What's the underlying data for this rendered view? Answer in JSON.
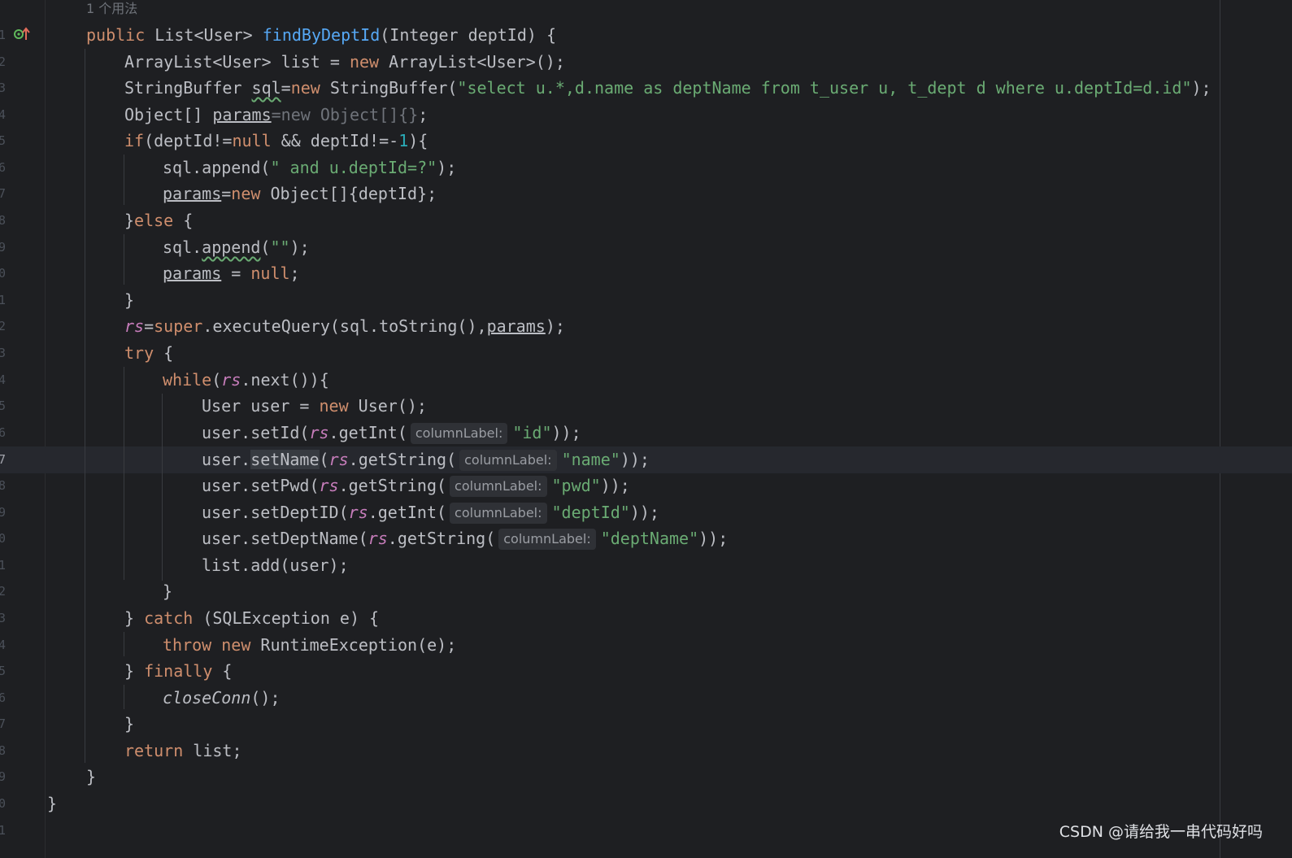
{
  "editor": {
    "usage_hint": "1 个用法",
    "watermark": "CSDN @请给我一串代码好吗"
  },
  "line_numbers": [
    "1",
    "2",
    "3",
    "4",
    "5",
    "6",
    "7",
    "8",
    "9",
    "0",
    "1",
    "2",
    "3",
    "4",
    "5",
    "6",
    "7",
    "8",
    "9",
    "0",
    "1",
    "2",
    "3",
    "4",
    "5",
    "6",
    "7",
    "8",
    "9",
    "0",
    "1"
  ],
  "code": {
    "l1": [
      "public",
      " List<User> ",
      "findByDeptId",
      "(Integer deptId) {"
    ],
    "l2": [
      "ArrayList<User> list = ",
      "new",
      " ArrayList<User>();"
    ],
    "l3": [
      "StringBuffer ",
      "sql",
      "=",
      "new",
      " StringBuffer(",
      "\"select u.*,d.name as deptName from t_user u, t_dept d where u.deptId=d.id\"",
      ");"
    ],
    "l4": [
      "Object[] ",
      "params",
      "=",
      "new Object[]{}",
      ";"
    ],
    "l5": [
      "if",
      "(deptId!=",
      "null",
      " && deptId!=-",
      "1",
      "){"
    ],
    "l6": [
      "sql.append(",
      "\" and u.deptId=?\"",
      ");"
    ],
    "l7": [
      "params",
      "=",
      "new",
      " Object[]{deptId};"
    ],
    "l8": [
      "}",
      "else",
      " {"
    ],
    "l9": [
      "sql.",
      "append",
      "(",
      "\"\"",
      ");"
    ],
    "l10": [
      "params",
      " = ",
      "null",
      ";"
    ],
    "l11": [
      "}"
    ],
    "l12": [
      "rs",
      "=",
      "super",
      ".executeQuery(sql.toString(),",
      "params",
      ");"
    ],
    "l13": [
      "try",
      " {"
    ],
    "l14": [
      "while",
      "(",
      "rs",
      ".next()){"
    ],
    "l15": [
      "User user = ",
      "new",
      " User();"
    ],
    "l16": [
      "user.setId(",
      "rs",
      ".getInt(",
      "columnLabel:",
      "\"id\"",
      "));"
    ],
    "l17": [
      "user.",
      "setName",
      "(",
      "rs",
      ".getString(",
      "columnLabel:",
      "\"name\"",
      "));"
    ],
    "l18": [
      "user.setPwd(",
      "rs",
      ".getString(",
      "columnLabel:",
      "\"pwd\"",
      "));"
    ],
    "l19": [
      "user.setDeptID(",
      "rs",
      ".getInt(",
      "columnLabel:",
      "\"deptId\"",
      "));"
    ],
    "l20": [
      "user.setDeptName(",
      "rs",
      ".getString(",
      "columnLabel:",
      "\"deptName\"",
      "));"
    ],
    "l21": [
      "list.add(user);"
    ],
    "l22": [
      "}"
    ],
    "l23": [
      "} ",
      "catch",
      " (SQLException e) {"
    ],
    "l24": [
      "throw",
      " ",
      "new",
      " RuntimeException(e);"
    ],
    "l25": [
      "} ",
      "finally",
      " {"
    ],
    "l26": [
      "closeConn",
      "();"
    ],
    "l27": [
      "}"
    ],
    "l28": [
      "return",
      " list;"
    ],
    "l29": [
      "}"
    ],
    "l30": [
      "}"
    ]
  },
  "colors": {
    "background": "#1e1f22",
    "keyword": "#cf8e6d",
    "function_decl": "#56a8f5",
    "string": "#6aab73",
    "number": "#2aacb8",
    "field": "#c77dbb",
    "text": "#bcbec4"
  },
  "icons": {
    "gutter_marker": "override-arrow-icon"
  }
}
